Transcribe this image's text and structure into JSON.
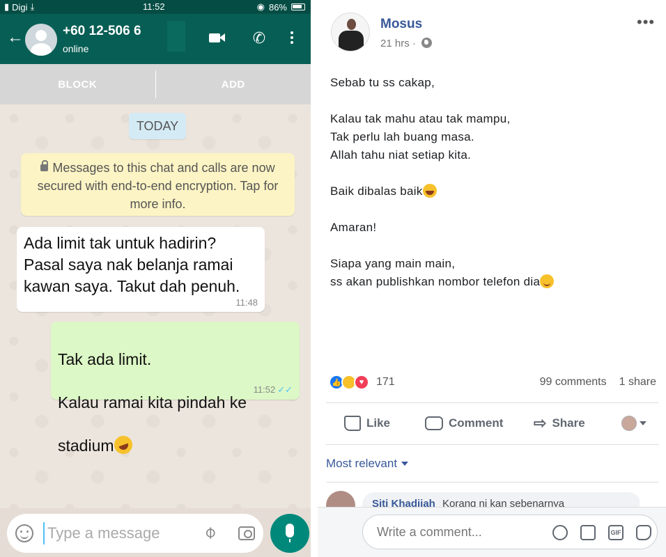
{
  "status_bar": {
    "carrier": "Digi",
    "time": "11:52",
    "battery": "86%"
  },
  "chat_header": {
    "contact_number": "+60 12-506 6",
    "status": "online"
  },
  "action_bar": {
    "block_label": "BLOCK",
    "add_label": "ADD"
  },
  "chat": {
    "date_chip": "TODAY",
    "encryption_notice": "Messages to this chat and calls are now secured with end-to-end encryption. Tap for more info.",
    "incoming": {
      "text": "Ada limit tak untuk hadirin?\nPasal saya nak belanja ramai\nkawan saya. Takut dah penuh.",
      "time": "11:48"
    },
    "outgoing": {
      "line1": "Tak ada limit.",
      "line2": "Kalau ramai kita pindah ke",
      "line3": "stadium",
      "time": "11:52",
      "ticks": "✓✓"
    }
  },
  "composer": {
    "placeholder": "Type a message"
  },
  "post": {
    "author": "Mosus",
    "time": "21 hrs",
    "lines": [
      "Sebab tu ss cakap,",
      "",
      "Kalau tak mahu atau tak mampu,",
      "Tak perlu lah buang masa.",
      "Allah tahu niat setiap kita.",
      "",
      "Baik dibalas baik",
      "",
      "Amaran!",
      "",
      "Siapa yang main main,",
      "ss akan publishkan nombor telefon dia"
    ],
    "reaction_count": "171",
    "comments": "99 comments",
    "shares": "1 share",
    "actions": {
      "like": "Like",
      "comment": "Comment",
      "share": "Share"
    },
    "sort_label": "Most relevant",
    "comment_preview": {
      "name": "Siti Khadijah",
      "text": "Korang ni kan sebenarnya"
    },
    "composer_placeholder": "Write a comment...",
    "gif_label": "GIF"
  }
}
